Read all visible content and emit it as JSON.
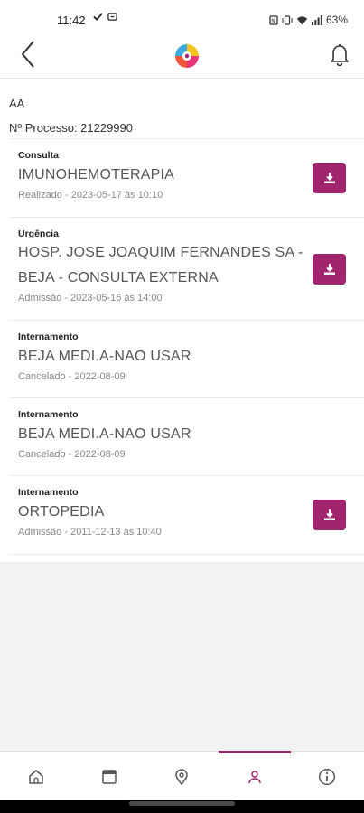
{
  "status_bar": {
    "time": "11:42",
    "battery": "63%",
    "left_icons": [
      "check-icon",
      "sync-icon"
    ],
    "right_icons": [
      "nfc-icon",
      "vibrate-icon",
      "wifi-icon",
      "signal-icon"
    ]
  },
  "header": {
    "back_icon": "chevron-left-icon",
    "logo": "app-logo",
    "bell_icon": "bell-icon"
  },
  "patient": {
    "name": "AA",
    "process_label": "Nº Processo: 21229990"
  },
  "episodes": [
    {
      "type": "Consulta",
      "title_lines": [
        "IMUNOHEMOTERAPIA"
      ],
      "meta": "Realizado - 2023-05-17 às 10:10",
      "has_download": true
    },
    {
      "type": "Urgência",
      "title_lines": [
        "HOSP. JOSE JOAQUIM FERNANDES SA -",
        "BEJA - CONSULTA EXTERNA"
      ],
      "meta": "Admissão - 2023-05-16 às 14:00",
      "has_download": true
    },
    {
      "type": "Internamento",
      "title_lines": [
        "BEJA MEDI.A-NAO USAR"
      ],
      "meta": "Cancelado - 2022-08-09",
      "has_download": false
    },
    {
      "type": "Internamento",
      "title_lines": [
        "BEJA MEDI.A-NAO USAR"
      ],
      "meta": "Cancelado - 2022-08-09",
      "has_download": false
    },
    {
      "type": "Internamento",
      "title_lines": [
        "ORTOPEDIA"
      ],
      "meta": "Admissão - 2011-12-13 às 10:40",
      "has_download": true
    }
  ],
  "bottom_nav": [
    {
      "icon": "home-icon",
      "active": false
    },
    {
      "icon": "calendar-icon",
      "active": false
    },
    {
      "icon": "location-pin-icon",
      "active": false
    },
    {
      "icon": "user-icon",
      "active": true
    },
    {
      "icon": "info-icon",
      "active": false
    }
  ],
  "colors": {
    "accent": "#a0246e",
    "background": "#f2f2f2"
  }
}
